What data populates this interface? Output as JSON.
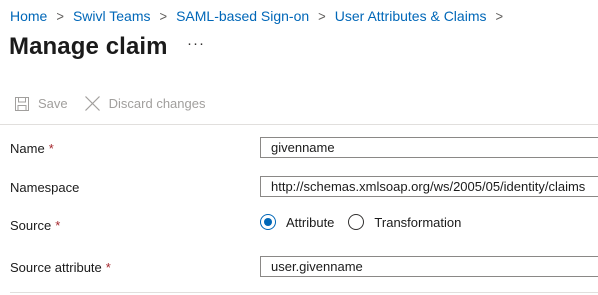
{
  "breadcrumb": {
    "items": [
      {
        "label": "Home"
      },
      {
        "label": "Swivl Teams"
      },
      {
        "label": "SAML-based Sign-on"
      },
      {
        "label": "User Attributes & Claims"
      }
    ],
    "separator": ">"
  },
  "page": {
    "title": "Manage claim",
    "more_label": "···"
  },
  "toolbar": {
    "save_label": "Save",
    "discard_label": "Discard changes",
    "save_icon": "save-icon",
    "discard_icon": "close-icon",
    "disabled_color": "#a19f9d"
  },
  "form": {
    "required_marker": "*",
    "name": {
      "label": "Name",
      "value": "givenname"
    },
    "namespace": {
      "label": "Namespace",
      "value": "http://schemas.xmlsoap.org/ws/2005/05/identity/claims"
    },
    "source": {
      "label": "Source",
      "options": [
        {
          "label": "Attribute",
          "selected": true
        },
        {
          "label": "Transformation",
          "selected": false
        }
      ]
    },
    "source_attribute": {
      "label": "Source attribute",
      "value": "user.givenname"
    }
  },
  "colors": {
    "link": "#0067b8",
    "required": "#a4262c",
    "accent": "#0067b8"
  }
}
